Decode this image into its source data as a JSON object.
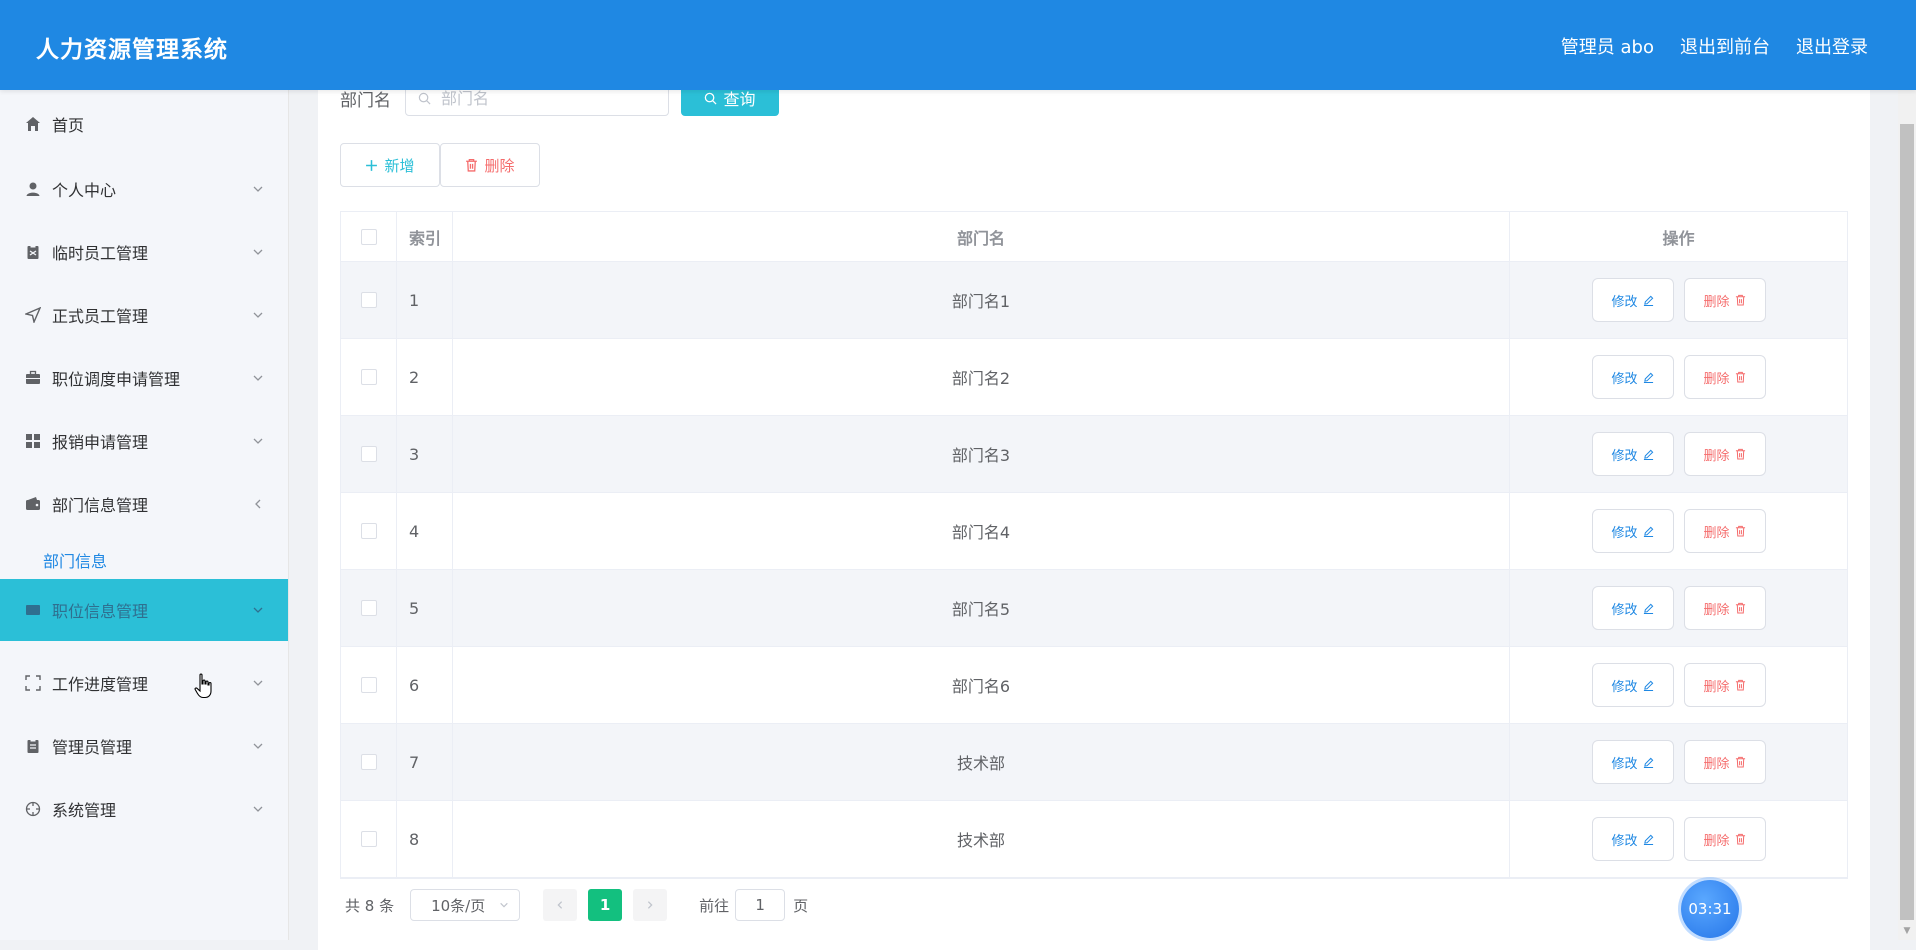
{
  "header": {
    "app_title": "人力资源管理系统",
    "user_label": "管理员 abo",
    "exit_front_label": "退出到前台",
    "logout_label": "退出登录"
  },
  "sidebar": {
    "items": [
      {
        "label": "首页",
        "icon": "home-icon",
        "expandable": false
      },
      {
        "label": "个人中心",
        "icon": "user-icon",
        "expandable": true
      },
      {
        "label": "临时员工管理",
        "icon": "clipboard-icon",
        "expandable": true
      },
      {
        "label": "正式员工管理",
        "icon": "send-icon",
        "expandable": true
      },
      {
        "label": "职位调度申请管理",
        "icon": "briefcase-icon",
        "expandable": true
      },
      {
        "label": "报销申请管理",
        "icon": "grid-icon",
        "expandable": true
      },
      {
        "label": "部门信息管理",
        "icon": "wallet-icon",
        "expandable": true,
        "expanded": true
      },
      {
        "label": "职位信息管理",
        "icon": "card-icon",
        "expandable": true,
        "active": true
      },
      {
        "label": "工作进度管理",
        "icon": "frame-icon",
        "expandable": true
      },
      {
        "label": "管理员管理",
        "icon": "document-icon",
        "expandable": true
      },
      {
        "label": "系统管理",
        "icon": "compass-icon",
        "expandable": true
      }
    ],
    "submenu_label": "部门信息"
  },
  "search": {
    "label": "部门名",
    "placeholder": "部门名",
    "query_label": "查询"
  },
  "actions": {
    "add_label": "新增",
    "delete_label": "删除"
  },
  "table": {
    "headers": {
      "index": "索引",
      "name": "部门名",
      "ops": "操作"
    },
    "edit_label": "修改",
    "delete_label": "删除",
    "rows": [
      {
        "index": "1",
        "name": "部门名1"
      },
      {
        "index": "2",
        "name": "部门名2"
      },
      {
        "index": "3",
        "name": "部门名3"
      },
      {
        "index": "4",
        "name": "部门名4"
      },
      {
        "index": "5",
        "name": "部门名5"
      },
      {
        "index": "6",
        "name": "部门名6"
      },
      {
        "index": "7",
        "name": "技术部"
      },
      {
        "index": "8",
        "name": "技术部"
      }
    ]
  },
  "pagination": {
    "total": "共 8 条",
    "page_size": "10条/页",
    "current_page": "1",
    "goto_label": "前往",
    "goto_value": "1",
    "goto_suffix": "页"
  },
  "timer": {
    "value": "03:31"
  },
  "colors": {
    "header_bg": "#1f88e3",
    "accent": "#2bbfd7",
    "danger": "#f56c6c",
    "pager_active": "#13c07f"
  }
}
